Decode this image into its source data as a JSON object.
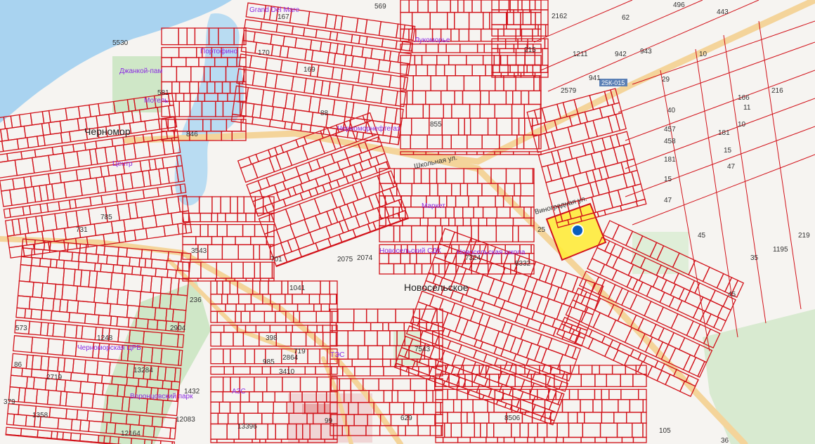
{
  "map": {
    "town_labels": [
      "Черномор",
      "Новосельское"
    ],
    "street_labels": [
      "Школьная ул.",
      "Виноградная ул."
    ],
    "road_badge": "25К-015",
    "poi": [
      "Grand Del Mare",
      "Портофино",
      "Джанкой-пам",
      "Мотель",
      "Лукоморье",
      "Черноморнефтегаз",
      "Центр",
      "Маркет",
      "Новосельский СДК",
      "ТЭС",
      "АЗС",
      "Воронцовский парк",
      "Черноморская ЦРБ",
      "Новосельская школа"
    ],
    "parcel_numbers": [
      "5530",
      "167",
      "569",
      "496",
      "443",
      "2162",
      "62",
      "170",
      "1211",
      "942",
      "943",
      "10",
      "2579",
      "941",
      "169",
      "88",
      "855",
      "29",
      "216",
      "166",
      "40",
      "11",
      "457",
      "10",
      "181",
      "458",
      "15",
      "181",
      "15",
      "47",
      "47",
      "25",
      "45",
      "219",
      "1195",
      "35",
      "45",
      "7324",
      "8332",
      "2074",
      "2075",
      "701",
      "1041",
      "785",
      "731",
      "3543",
      "2904",
      "236",
      "573",
      "1248",
      "86",
      "2719",
      "379",
      "1358",
      "13284",
      "1432",
      "12083",
      "12164",
      "13396",
      "398",
      "985",
      "3410",
      "719",
      "2864",
      "7543",
      "629",
      "8506",
      "99",
      "105",
      "36",
      "581",
      "215",
      "846"
    ],
    "marker": {
      "label": "selected-parcel",
      "color": "#0a5ebd"
    },
    "colors": {
      "parcel_stroke": "#d2121a",
      "selected_fill": "#ffeb3b",
      "water": "#a9d3f0",
      "green": "#cfe7c7",
      "road": "#f4d49a",
      "background": "#f6f4f1"
    }
  }
}
